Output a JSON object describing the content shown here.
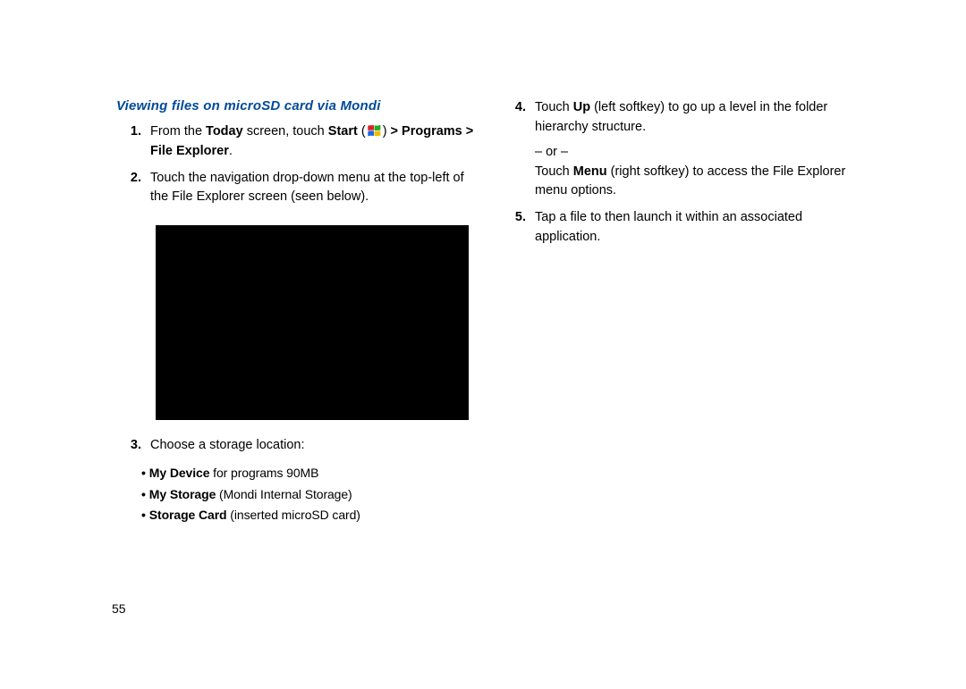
{
  "heading": "Viewing files on microSD card via Mondi",
  "steps": {
    "s1": {
      "num": "1.",
      "pre": "From the ",
      "today": "Today",
      "mid": " screen, touch ",
      "start": "Start",
      "lp": " (",
      "rp": ") ",
      "programs": "> Programs > File Explorer",
      "tail": "."
    },
    "s2": {
      "num": "2.",
      "text": "Touch the navigation drop-down menu at the top-left of the File Explorer screen (seen below)."
    },
    "s3": {
      "num": "3.",
      "text": "Choose a storage location:"
    },
    "s4": {
      "num": "4.",
      "pre": "Touch ",
      "up": "Up",
      "mid": " (left softkey) to go up a level in the folder hierarchy structure."
    },
    "s4or": "– or –",
    "s4b": {
      "pre": "Touch ",
      "menu": "Menu",
      "mid": " (right softkey) to access the File Explorer menu options."
    },
    "s5": {
      "num": "5.",
      "text": "Tap a file to then launch it within an associated application."
    }
  },
  "bullets": {
    "b1": {
      "bold": "My Device",
      "rest": " for programs 90MB"
    },
    "b2": {
      "bold": "My Storage",
      "rest": " (Mondi Internal Storage)"
    },
    "b3": {
      "bold": "Storage Card",
      "rest": " (inserted microSD card)"
    }
  },
  "page_number": "55"
}
